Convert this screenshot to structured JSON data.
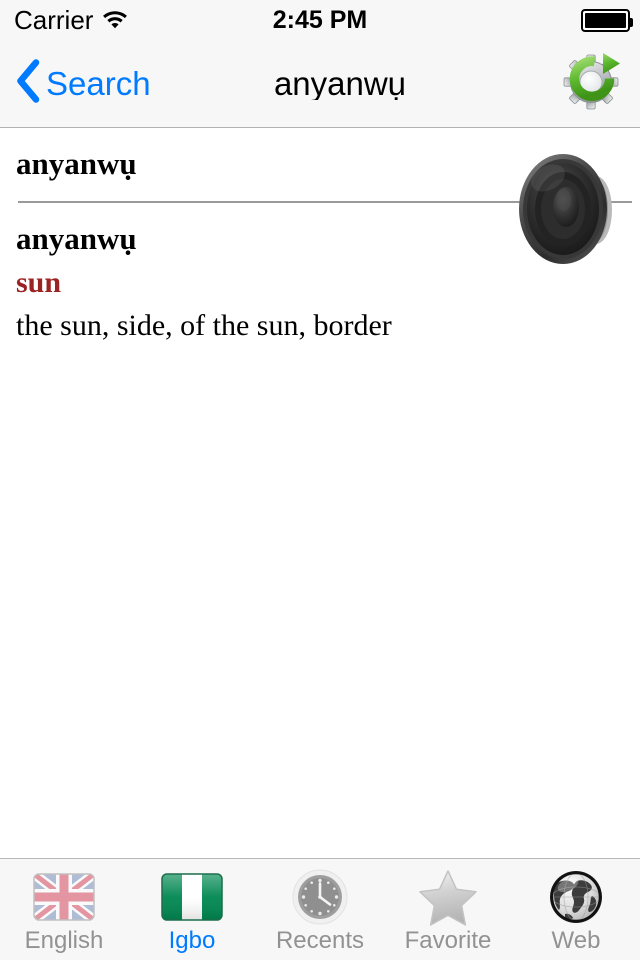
{
  "status_bar": {
    "carrier": "Carrier",
    "wifi_icon": "wifi-icon",
    "time": "2:45 PM",
    "battery_icon": "battery-full-icon"
  },
  "nav_bar": {
    "back_icon": "chevron-left-icon",
    "back_label": "Search",
    "title": "anyanwụ",
    "action_icon": "gear-refresh-icon",
    "tint_color": "#007AFF"
  },
  "entry": {
    "headword": "anyanwụ",
    "term": "anyanwụ",
    "sense": "sun",
    "sense_color": "#9B2323",
    "gloss": "the sun, side, of the sun, border",
    "speak_icon": "speaker-icon"
  },
  "tab_bar": {
    "active_index": 1,
    "items": [
      {
        "label": "English",
        "icon": "uk-flag-icon"
      },
      {
        "label": "Igbo",
        "icon": "nigeria-flag-icon"
      },
      {
        "label": "Recents",
        "icon": "clock-icon"
      },
      {
        "label": "Favorite",
        "icon": "star-icon"
      },
      {
        "label": "Web",
        "icon": "globe-icon"
      }
    ]
  }
}
